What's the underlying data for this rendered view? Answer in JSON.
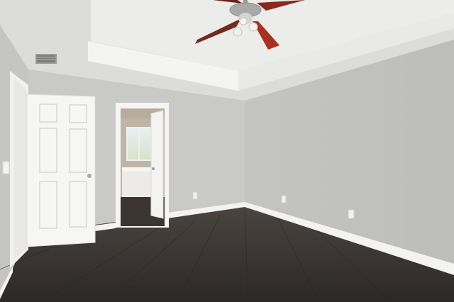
{
  "image": {
    "subject": "empty bedroom",
    "colors": {
      "wall_left": "#c9c9c7",
      "wall_back": "#c8c8c6",
      "wall_right": "#c2c2c1",
      "ceiling": "#e3e3e1",
      "tray_face": "#f2f2f0",
      "trim": "#f7f7f5",
      "floor": "#3d3835",
      "floor_dark": "#2c2826",
      "door": "#f6f6f4",
      "fan_blade": "#8b2a1c",
      "fan_metal": "#a9a9a9"
    },
    "objects": [
      {
        "name": "ceiling-fan",
        "type": "fixture"
      },
      {
        "name": "hvac-vent",
        "type": "fixture"
      },
      {
        "name": "open-white-door",
        "type": "door"
      },
      {
        "name": "bathroom-doorway",
        "type": "doorway"
      },
      {
        "name": "wall-outlet",
        "type": "fixture"
      },
      {
        "name": "hardwood-floor",
        "type": "surface"
      }
    ]
  }
}
